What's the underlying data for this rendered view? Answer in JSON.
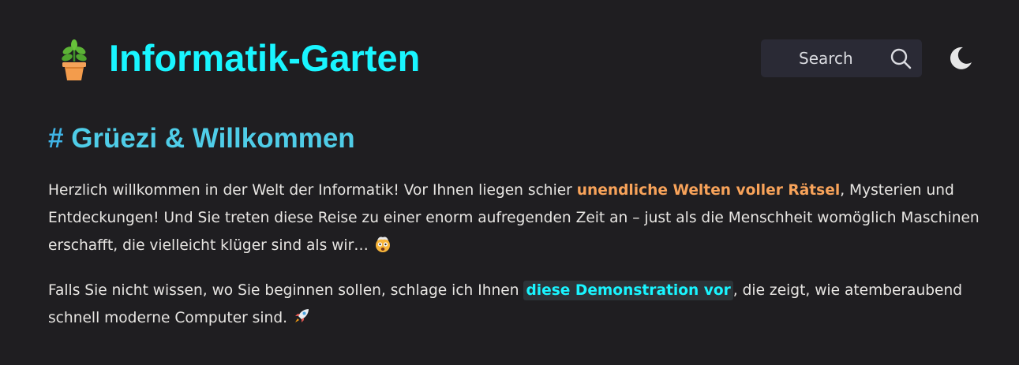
{
  "header": {
    "site_title": "Informatik-Garten",
    "logo_icon": "potted-plant-icon",
    "search_label": "Search",
    "search_icon": "search-icon",
    "theme_toggle_icon": "moon-icon"
  },
  "main": {
    "heading_hash": "#",
    "heading_text": "Grüezi & Willkommen",
    "p1": {
      "part1": "Herzlich willkommen in der Welt der Informatik! Vor Ihnen liegen schier ",
      "highlight": "unendliche Welten voller Rätsel",
      "part2": ", Mysterien und Entdeckungen! Und Sie treten diese Reise zu einer enorm aufregenden Zeit an – just als die Menschheit womöglich Maschinen erschafft, die vielleicht klüger sind als wir… ",
      "emoji": "exploding-head-icon"
    },
    "p2": {
      "part1": "Falls Sie nicht wissen, wo Sie beginnen sollen, schlage ich Ihnen ",
      "link": "diese Demonstration vor",
      "part2": ", die zeigt, wie atemberaubend schnell moderne Computer sind. ",
      "emoji": "rocket-icon"
    }
  },
  "colors": {
    "background": "#1f1e21",
    "title": "#19f5ff",
    "heading": "#4fcde8",
    "body_text": "#e8e6e3",
    "highlight_orange": "#f8a35a",
    "link": "#19f5ff"
  }
}
